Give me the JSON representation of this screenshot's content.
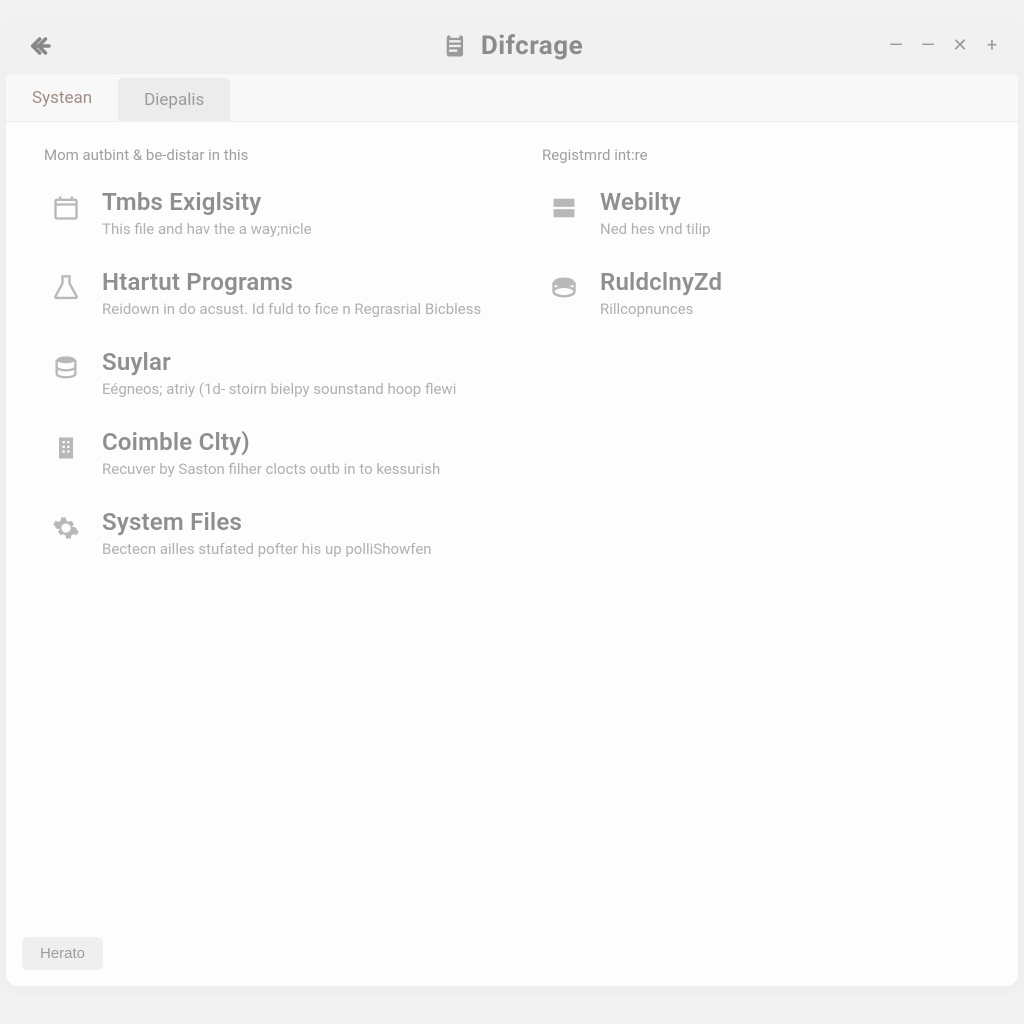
{
  "titlebar": {
    "title": "Difcrage"
  },
  "tabs": [
    {
      "label": "Systean",
      "active": true
    },
    {
      "label": "Diepalis",
      "active": false
    }
  ],
  "left": {
    "heading": "Mom autbint & be-distar in this",
    "items": [
      {
        "title": "Tmbs Exiglsity",
        "desc": "This file and hav the a way;nicle"
      },
      {
        "title": "Htartut Programs",
        "desc": "Reidown in do acsust. Id fuld to fice n Regrasrial Bicbless"
      },
      {
        "title": "Suylar",
        "desc": "Eégneos; atriy (1d- stoirn bielpy sounstand hoop flewi"
      },
      {
        "title": "Coimble Clty)",
        "desc": "Recuver by Saston filher clocts outb in to kessurish"
      },
      {
        "title": "System Files",
        "desc": "Bectecn ailles stufated pofter his up polliShowfen"
      }
    ]
  },
  "right": {
    "heading": "Registmrd int:re",
    "items": [
      {
        "title": "Webilty",
        "desc": "Ned hes vnd tilip"
      },
      {
        "title": "RuldclnyZd",
        "desc": "Rillcopnunces"
      }
    ]
  },
  "footer": {
    "button": "Herato"
  }
}
